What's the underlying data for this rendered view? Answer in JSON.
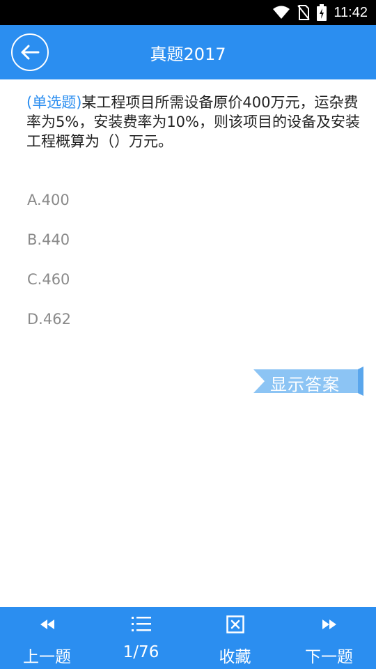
{
  "status_bar": {
    "time": "11:42",
    "icons": [
      "wifi-icon",
      "no-sim-icon",
      "battery-charging-icon"
    ]
  },
  "header": {
    "title": "真题2017",
    "back_icon": "arrow-left-icon"
  },
  "question": {
    "type_label": "(单选题)",
    "text": "某工程项目所需设备原价400万元，运杂费率为5%，安装费率为10%，则该项目的设备及安装工程概算为（）万元。"
  },
  "options": [
    {
      "label": "A.400"
    },
    {
      "label": "B.440"
    },
    {
      "label": "C.460"
    },
    {
      "label": "D.462"
    }
  ],
  "show_answer_label": "显示答案",
  "bottom_nav": {
    "prev": {
      "label": "上一题",
      "icon": "rewind-icon"
    },
    "progress": {
      "label": "1/76",
      "icon": "list-icon"
    },
    "favorite": {
      "label": "收藏",
      "icon": "checkbox-x-icon"
    },
    "next": {
      "label": "下一题",
      "icon": "fast-forward-icon"
    }
  },
  "colors": {
    "primary": "#2b8ef0",
    "option_text": "#8a8a8a",
    "answer_button": "#8cc4f4"
  }
}
